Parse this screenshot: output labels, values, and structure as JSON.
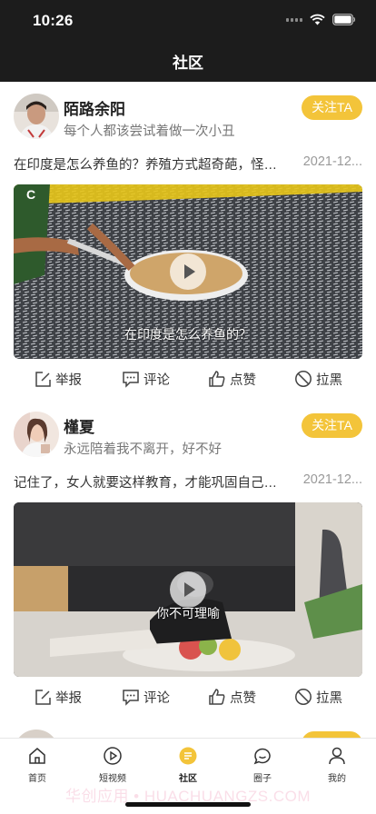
{
  "status_bar": {
    "time": "10:26"
  },
  "header": {
    "title": "社区"
  },
  "posts": [
    {
      "username": "陌路余阳",
      "bio": "每个人都该尝试着做一次小丑",
      "follow_label": "关注TA",
      "text": "在印度是怎么养鱼的？养殖方式超奇葩，怪不得印度人不吃鱼",
      "date": "2021-12...",
      "video_subtitle": "在印度是怎么养鱼的？",
      "actions": {
        "report": "举报",
        "comment": "评论",
        "like": "点赞",
        "block": "拉黑"
      }
    },
    {
      "username": "槿夏",
      "bio": "永远陪着我不离开，好不好",
      "follow_label": "关注TA",
      "text": "记住了，女人就要这样教育，才能巩固自己的地位",
      "date": "2021-12...",
      "video_subtitle": "你不可理喻",
      "actions": {
        "report": "举报",
        "comment": "评论",
        "like": "点赞",
        "block": "拉黑"
      }
    },
    {
      "username": "",
      "follow_label": ""
    }
  ],
  "tabbar": {
    "items": [
      {
        "label": "首页",
        "icon": "home-icon"
      },
      {
        "label": "短视频",
        "icon": "play-circle-icon"
      },
      {
        "label": "社区",
        "icon": "community-icon",
        "active": true
      },
      {
        "label": "圈子",
        "icon": "chat-bubble-icon"
      },
      {
        "label": "我的",
        "icon": "person-icon"
      }
    ]
  },
  "watermark": "华创应用 • HUACHUANGZS.COM",
  "colors": {
    "accent": "#f3c43a",
    "header_bg": "#1c1c1c"
  }
}
